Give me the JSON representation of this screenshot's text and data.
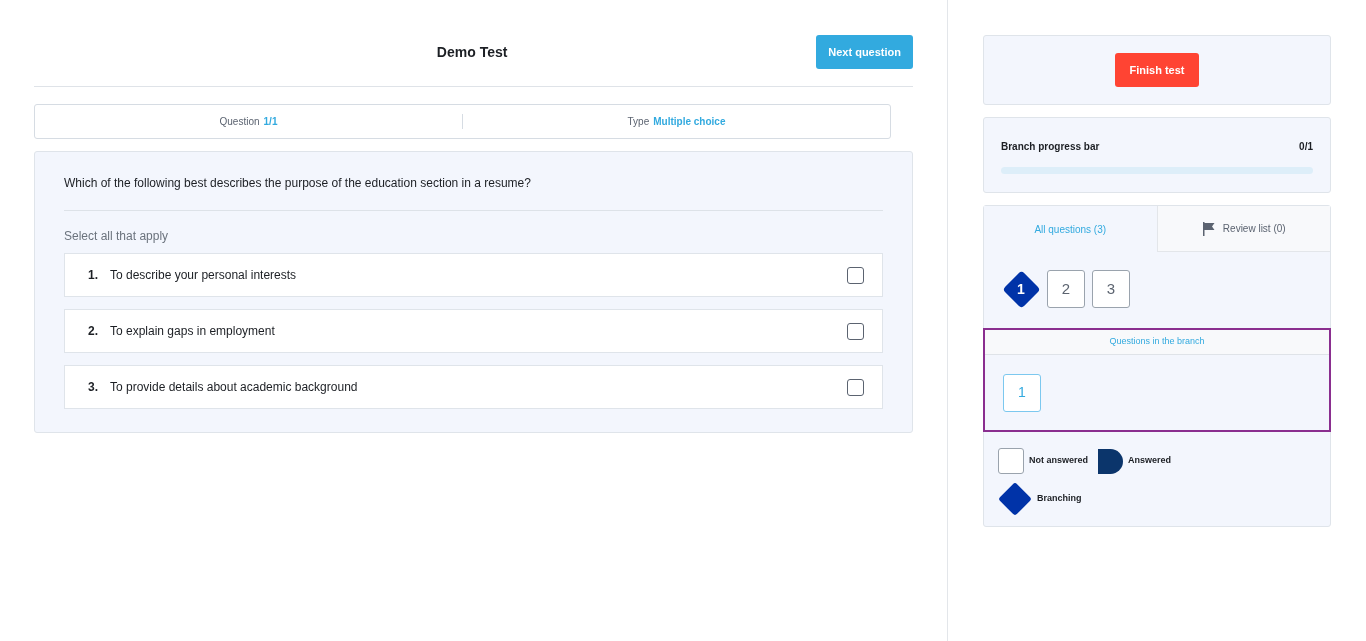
{
  "header": {
    "title": "Demo Test",
    "next_button": "Next question"
  },
  "info": [
    {
      "label": "Question",
      "value": "1/1"
    },
    {
      "label": "Type",
      "value": "Multiple choice"
    }
  ],
  "question": {
    "text": "Which of the following best describes the purpose of the education section in a resume?",
    "hint": "Select all that apply",
    "options": [
      {
        "number": "1.",
        "text": "To describe your personal interests",
        "checked": false
      },
      {
        "number": "2.",
        "text": "To explain gaps in employment",
        "checked": false
      },
      {
        "number": "3.",
        "text": "To provide details about academic background",
        "checked": false
      }
    ]
  },
  "sidebar": {
    "finish_button": "Finish test",
    "progress": {
      "label": "Branch progress bar",
      "count": "0/1",
      "level": 0
    },
    "tabs": [
      {
        "label": "All questions (3)",
        "selected": true,
        "kind": "plain"
      },
      {
        "label": "Review list (0)",
        "selected": false,
        "kind": "review"
      }
    ],
    "questions": [
      {
        "label": "1",
        "kind": "branching"
      },
      {
        "label": "2",
        "kind": "not_answered"
      },
      {
        "label": "3",
        "kind": "not_answered"
      }
    ],
    "branch": {
      "title": "Questions in the branch",
      "questions": [
        {
          "label": "1",
          "selected": true
        }
      ]
    },
    "legend": [
      {
        "label": "Not answered",
        "kind": "not_answered"
      },
      {
        "label": "Answered",
        "kind": "answered"
      },
      {
        "label": "Branching",
        "kind": "branching"
      }
    ]
  }
}
